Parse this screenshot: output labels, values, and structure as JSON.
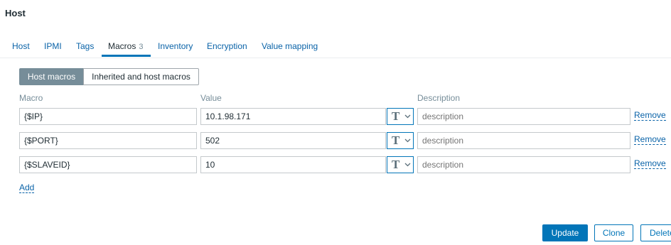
{
  "page": {
    "title": "Host"
  },
  "tabs": [
    {
      "label": "Host"
    },
    {
      "label": "IPMI"
    },
    {
      "label": "Tags"
    },
    {
      "label": "Macros",
      "count": "3"
    },
    {
      "label": "Inventory"
    },
    {
      "label": "Encryption"
    },
    {
      "label": "Value mapping"
    }
  ],
  "active_tab": "Macros",
  "macro_view": {
    "host_macros_label": "Host macros",
    "inherited_label": "Inherited and host macros",
    "selected": "Host macros"
  },
  "columns": {
    "macro": "Macro",
    "value": "Value",
    "description": "Description"
  },
  "macros": [
    {
      "macro": "{$IP}",
      "value": "10.1.98.171",
      "description_placeholder": "description",
      "type_icon": "T",
      "remove_label": "Remove"
    },
    {
      "macro": "{$PORT}",
      "value": "502",
      "description_placeholder": "description",
      "type_icon": "T",
      "remove_label": "Remove"
    },
    {
      "macro": "{$SLAVEID}",
      "value": "10",
      "description_placeholder": "description",
      "type_icon": "T",
      "remove_label": "Remove"
    }
  ],
  "add_label": "Add",
  "buttons": {
    "update": "Update",
    "clone": "Clone",
    "delete": "Delete"
  },
  "colors": {
    "link": "#0a63a8",
    "primary": "#0275b8",
    "muted": "#768d99"
  }
}
